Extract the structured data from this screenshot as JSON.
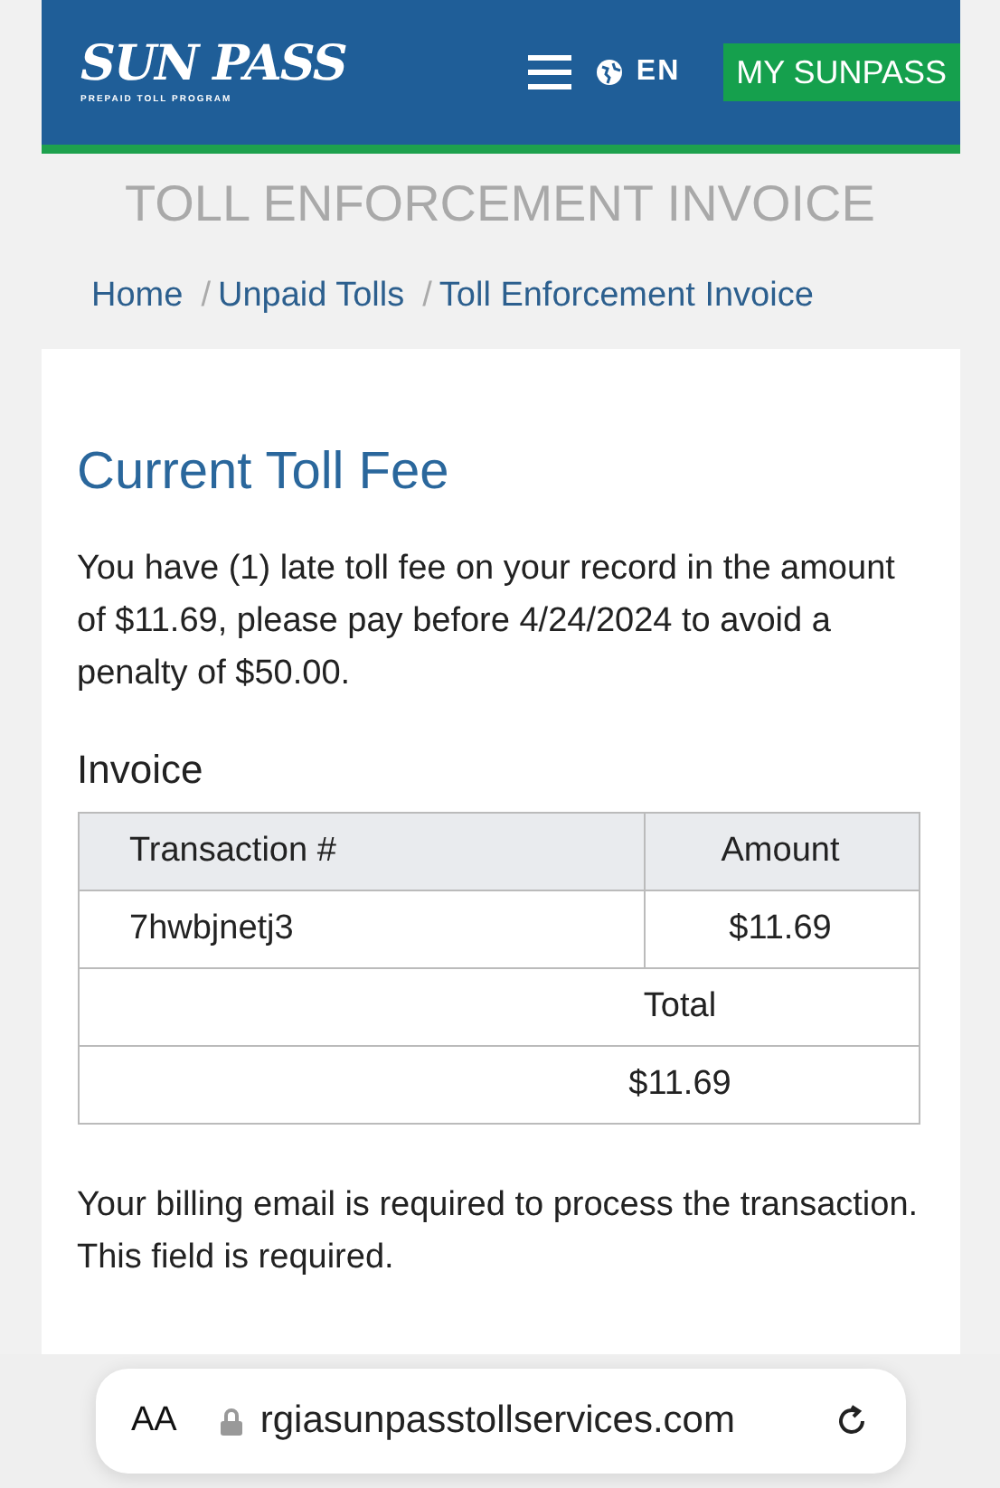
{
  "header": {
    "logo": {
      "name": "SUN PASS",
      "tagline": "PREPAID TOLL PROGRAM"
    },
    "language": "EN",
    "account_button": "MY SUNPASS"
  },
  "page_title": "TOLL ENFORCEMENT INVOICE",
  "breadcrumb": [
    "Home",
    "Unpaid Tolls",
    "Toll Enforcement Invoice"
  ],
  "breadcrumb_separator": "/",
  "heading": "Current Toll Fee",
  "notice": "You have (1) late toll fee on your record in the amount of $11.69, please pay before 4/24/2024 to avoid a penalty of $50.00.",
  "invoice": {
    "title": "Invoice",
    "columns": [
      "Transaction #",
      "Amount"
    ],
    "rows": [
      {
        "transaction": "7hwbjnetj3",
        "amount": "$11.69"
      }
    ],
    "total_label": "Total",
    "total": "$11.69"
  },
  "billing_note": "Your billing email is required to process the transaction. This field is required.",
  "browser_bar": {
    "text_size": "AA",
    "url": "rgiasunpasstollservices.com"
  }
}
